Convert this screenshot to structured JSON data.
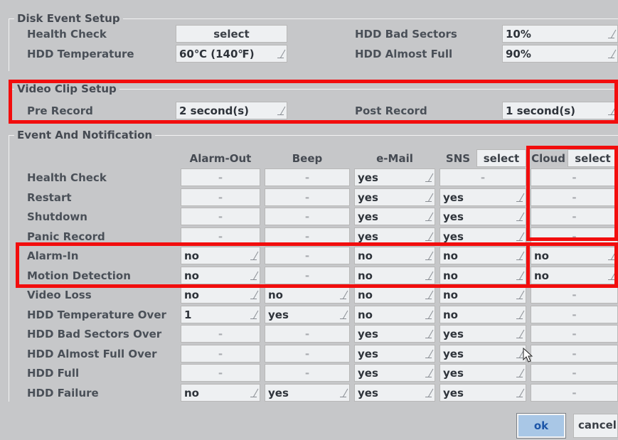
{
  "disk_event_setup": {
    "title": "Disk Event Setup",
    "health_check_label": "Health Check",
    "health_check_value": "select",
    "hdd_temperature_label": "HDD Temperature",
    "hdd_temperature_value": "60℃ (140℉)",
    "hdd_bad_sectors_label": "HDD Bad Sectors",
    "hdd_bad_sectors_value": "10%",
    "hdd_almost_full_label": "HDD Almost Full",
    "hdd_almost_full_value": "90%"
  },
  "video_clip_setup": {
    "title": "Video Clip Setup",
    "pre_record_label": "Pre Record",
    "pre_record_value": "2 second(s)",
    "post_record_label": "Post Record",
    "post_record_value": "1 second(s)"
  },
  "event_notification": {
    "title": "Event And Notification",
    "columns": {
      "alarm_out": "Alarm-Out",
      "beep": "Beep",
      "email": "e-Mail",
      "sns": "SNS",
      "sns_select": "select",
      "cloud": "Cloud",
      "cloud_select": "select"
    },
    "rows": [
      {
        "label": "Health Check",
        "alarm_out": "-",
        "beep": "-",
        "email": "yes",
        "sns": "-",
        "cloud": "-"
      },
      {
        "label": "Restart",
        "alarm_out": "-",
        "beep": "-",
        "email": "yes",
        "sns": "yes",
        "cloud": "-"
      },
      {
        "label": "Shutdown",
        "alarm_out": "-",
        "beep": "-",
        "email": "yes",
        "sns": "yes",
        "cloud": "-"
      },
      {
        "label": "Panic Record",
        "alarm_out": "-",
        "beep": "-",
        "email": "yes",
        "sns": "yes",
        "cloud": "-"
      },
      {
        "label": "Alarm-In",
        "alarm_out": "no",
        "beep": "-",
        "email": "no",
        "sns": "no",
        "cloud": "no"
      },
      {
        "label": "Motion Detection",
        "alarm_out": "no",
        "beep": "-",
        "email": "no",
        "sns": "no",
        "cloud": "no"
      },
      {
        "label": "Video Loss",
        "alarm_out": "no",
        "beep": "no",
        "email": "no",
        "sns": "no",
        "cloud": "-"
      },
      {
        "label": "HDD Temperature Over",
        "alarm_out": "1",
        "beep": "yes",
        "email": "no",
        "sns": "no",
        "cloud": "-"
      },
      {
        "label": "HDD Bad Sectors Over",
        "alarm_out": "-",
        "beep": "-",
        "email": "yes",
        "sns": "yes",
        "cloud": "-"
      },
      {
        "label": "HDD Almost Full Over",
        "alarm_out": "-",
        "beep": "-",
        "email": "yes",
        "sns": "yes",
        "cloud": "-"
      },
      {
        "label": "HDD Full",
        "alarm_out": "-",
        "beep": "-",
        "email": "yes",
        "sns": "yes",
        "cloud": "-"
      },
      {
        "label": "HDD Failure",
        "alarm_out": "no",
        "beep": "yes",
        "email": "yes",
        "sns": "yes",
        "cloud": "-"
      }
    ]
  },
  "buttons": {
    "ok": "ok",
    "cancel": "cancel"
  },
  "colors": {
    "background": "#c6c7c9",
    "field": "#eef0f2",
    "highlight": "#f20d0d",
    "ok_bg": "#a9c7e6"
  }
}
